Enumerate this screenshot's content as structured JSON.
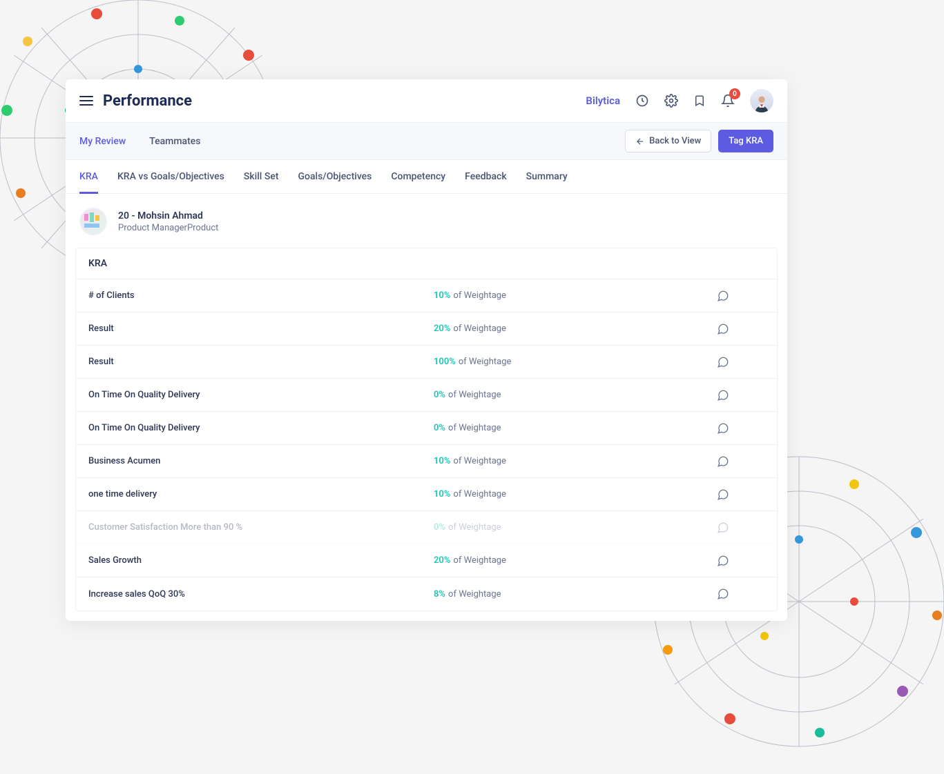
{
  "header": {
    "title": "Performance",
    "brand": "Bilytica",
    "notification_count": "0"
  },
  "subnav": {
    "tabs": [
      {
        "label": "My Review",
        "active": true
      },
      {
        "label": "Teammates",
        "active": false
      }
    ],
    "back_label": "Back to View",
    "tag_label": "Tag KRA"
  },
  "content_tabs": [
    {
      "label": "KRA",
      "active": true
    },
    {
      "label": "KRA vs Goals/Objectives",
      "active": false
    },
    {
      "label": "Skill Set",
      "active": false
    },
    {
      "label": "Goals/Objectives",
      "active": false
    },
    {
      "label": "Competency",
      "active": false
    },
    {
      "label": "Feedback",
      "active": false
    },
    {
      "label": "Summary",
      "active": false
    }
  ],
  "profile": {
    "name": "20 - Mohsin Ahmad",
    "role": "Product ManagerProduct"
  },
  "kra": {
    "section_title": "KRA",
    "weight_suffix": "of Weightage",
    "rows": [
      {
        "name": "# of Clients",
        "pct": "10%",
        "ghost": false
      },
      {
        "name": "Result",
        "pct": "20%",
        "ghost": false
      },
      {
        "name": "Result",
        "pct": "100%",
        "ghost": false
      },
      {
        "name": "On Time On Quality Delivery",
        "pct": "0%",
        "ghost": false
      },
      {
        "name": "On Time On Quality Delivery",
        "pct": "0%",
        "ghost": false
      },
      {
        "name": "Business Acumen",
        "pct": "10%",
        "ghost": false
      },
      {
        "name": "one time delivery",
        "pct": "10%",
        "ghost": false
      },
      {
        "name": "Customer Satisfaction More than 90 %",
        "pct": "0%",
        "ghost": true
      },
      {
        "name": "Sales Growth",
        "pct": "20%",
        "ghost": false
      },
      {
        "name": "Increase sales QoQ 30%",
        "pct": "8%",
        "ghost": false
      }
    ]
  }
}
